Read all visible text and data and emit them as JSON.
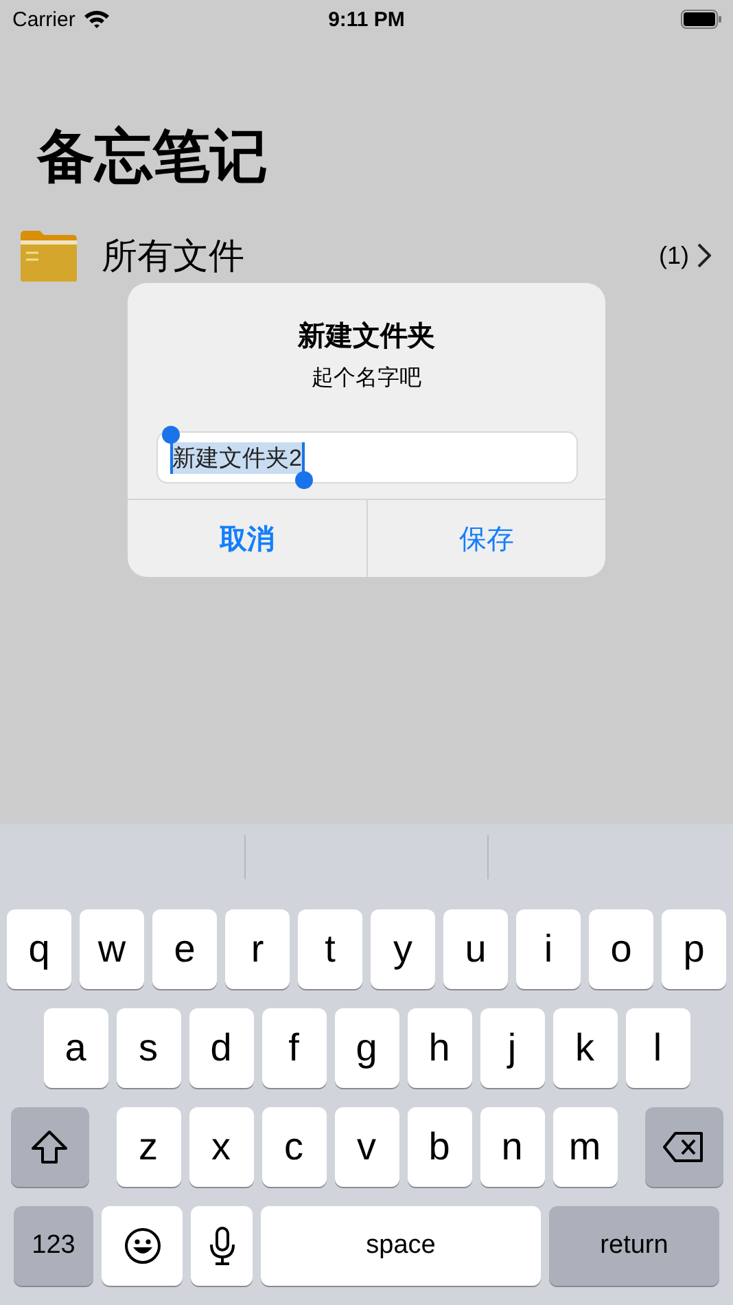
{
  "status_bar": {
    "carrier": "Carrier",
    "time": "9:11 PM"
  },
  "title": "备忘笔记",
  "folders": [
    {
      "name": "所有文件",
      "count": "(1)"
    }
  ],
  "dialog": {
    "title": "新建文件夹",
    "message": "起个名字吧",
    "field": {
      "value": "新建文件夹2",
      "text_selected": true
    },
    "buttons": [
      {
        "label": "取消",
        "bold": true
      },
      {
        "label": "保存",
        "bold": false
      }
    ]
  },
  "keyboard": {
    "key_rows": [
      {
        "keys": [
          {
            "kind": "letter",
            "label": "q"
          },
          {
            "kind": "letter",
            "label": "w"
          },
          {
            "kind": "letter",
            "label": "e"
          },
          {
            "kind": "letter",
            "label": "r"
          },
          {
            "kind": "letter",
            "label": "t"
          },
          {
            "kind": "letter",
            "label": "y"
          },
          {
            "kind": "letter",
            "label": "u"
          },
          {
            "kind": "letter",
            "label": "i"
          },
          {
            "kind": "letter",
            "label": "o"
          },
          {
            "kind": "letter",
            "label": "p"
          }
        ]
      },
      {
        "keys": [
          {
            "kind": "letter",
            "label": "a"
          },
          {
            "kind": "letter",
            "label": "s"
          },
          {
            "kind": "letter",
            "label": "d"
          },
          {
            "kind": "letter",
            "label": "f"
          },
          {
            "kind": "letter",
            "label": "g"
          },
          {
            "kind": "letter",
            "label": "h"
          },
          {
            "kind": "letter",
            "label": "j"
          },
          {
            "kind": "letter",
            "label": "k"
          },
          {
            "kind": "letter",
            "label": "l"
          }
        ]
      },
      {
        "keys": [
          {
            "kind": "shift"
          },
          {
            "kind": "letter",
            "label": "z"
          },
          {
            "kind": "letter",
            "label": "x"
          },
          {
            "kind": "letter",
            "label": "c"
          },
          {
            "kind": "letter",
            "label": "v"
          },
          {
            "kind": "letter",
            "label": "b"
          },
          {
            "kind": "letter",
            "label": "n"
          },
          {
            "kind": "letter",
            "label": "m"
          },
          {
            "kind": "delete"
          }
        ]
      },
      {
        "keys": [
          {
            "kind": "numbers",
            "label": "123"
          },
          {
            "kind": "emoji"
          },
          {
            "kind": "mic"
          },
          {
            "kind": "space",
            "label": "space"
          },
          {
            "kind": "return",
            "label": "return"
          }
        ]
      }
    ]
  }
}
